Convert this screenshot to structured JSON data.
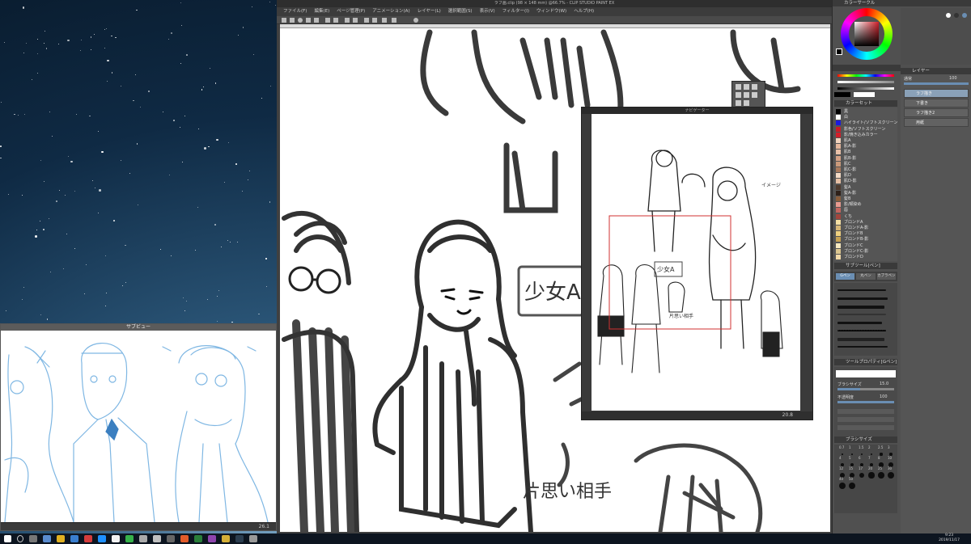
{
  "app": {
    "title": "ラフ画.clip (98 × 148 mm) @66.7% - CLIP STUDIO PAINT EX",
    "menus": [
      "ファイル(F)",
      "編集(E)",
      "ページ管理(P)",
      "アニメーション(A)",
      "レイヤー(L)",
      "選択範囲(S)",
      "表示(V)",
      "フィルター(I)",
      "ウィンドウ(W)",
      "ヘルプ(H)"
    ],
    "canvas_notes": [
      "少女A",
      "片思い相手"
    ],
    "status_zoom": "66.7"
  },
  "subwindow": {
    "title": "サブビュー",
    "status": "26.1"
  },
  "navigator": {
    "title": "ナビゲーター",
    "notes": [
      "少女A",
      "片思い相手",
      "イメージ"
    ],
    "zoom": "20.8"
  },
  "color_panel": {
    "header": "カラーサークル"
  },
  "swatch_panel": {
    "header": "カラーセット",
    "items": [
      {
        "label": "黒",
        "color": "#000000"
      },
      {
        "label": "白",
        "color": "#ffffff"
      },
      {
        "label": "ハイライト/ソフトスクリーン",
        "color": "#1a1adf"
      },
      {
        "label": "影色/ソフトスクリーン",
        "color": "#cc1b26"
      },
      {
        "label": "影/焼き込みカラー",
        "color": "#d21e2a"
      },
      {
        "label": "肌A",
        "color": "#f1d3bd"
      },
      {
        "label": "肌A-影",
        "color": "#e4b69b"
      },
      {
        "label": "肌B",
        "color": "#e9c1a8"
      },
      {
        "label": "肌B-影",
        "color": "#d5a185"
      },
      {
        "label": "肌C",
        "color": "#c9997a"
      },
      {
        "label": "肌C-影",
        "color": "#a97a5d"
      },
      {
        "label": "肌D",
        "color": "#f5dbc6"
      },
      {
        "label": "肌D-影",
        "color": "#e6bfa3"
      },
      {
        "label": "髪A",
        "color": "#4e3a2d"
      },
      {
        "label": "髪A-影",
        "color": "#2f2119"
      },
      {
        "label": "髪B",
        "color": "#8a5e3c"
      },
      {
        "label": "影/頬染め",
        "color": "#e89a8f"
      },
      {
        "label": "唇",
        "color": "#c3665f"
      },
      {
        "label": "くち",
        "color": "#a3453d"
      },
      {
        "label": "ブロンドA",
        "color": "#f5e0a3"
      },
      {
        "label": "ブロンドA-影",
        "color": "#d8b878"
      },
      {
        "label": "ブロンドB",
        "color": "#efd07f"
      },
      {
        "label": "ブロンドB-影",
        "color": "#c7a253"
      },
      {
        "label": "ブロンドC",
        "color": "#f7e9c0"
      },
      {
        "label": "ブロンドC-影",
        "color": "#dbc58f"
      },
      {
        "label": "ブロンドD",
        "color": "#f2d9a8"
      }
    ]
  },
  "layer_panel": {
    "header": "レイヤー",
    "blend": "通常",
    "opacity": "100",
    "layers": [
      {
        "name": "ラフ描き",
        "selected": true
      },
      {
        "name": "下書き",
        "selected": false
      },
      {
        "name": "ラフ描き2",
        "selected": false
      },
      {
        "name": "用紙",
        "selected": false
      }
    ]
  },
  "tool_panel": {
    "header": "サブツール[ペン]",
    "tabs": [
      "Gペン",
      "丸ペン",
      "カブラペン"
    ]
  },
  "tool_property": {
    "header": "ツールプロパティ[Gペン]",
    "size_label": "ブラシサイズ",
    "size_value": "15.0",
    "opacity_label": "不透明度",
    "opacity_value": "100"
  },
  "brush_size": {
    "header": "ブラシサイズ",
    "sizes": [
      "0.7",
      "1",
      "1.5",
      "2",
      "2.5",
      "3",
      "4",
      "5",
      "6",
      "7",
      "8",
      "10",
      "12",
      "15",
      "17",
      "20",
      "25",
      "30",
      "40",
      "50"
    ]
  },
  "taskbar": {
    "time": "9:23",
    "date": "2019/11/17"
  }
}
